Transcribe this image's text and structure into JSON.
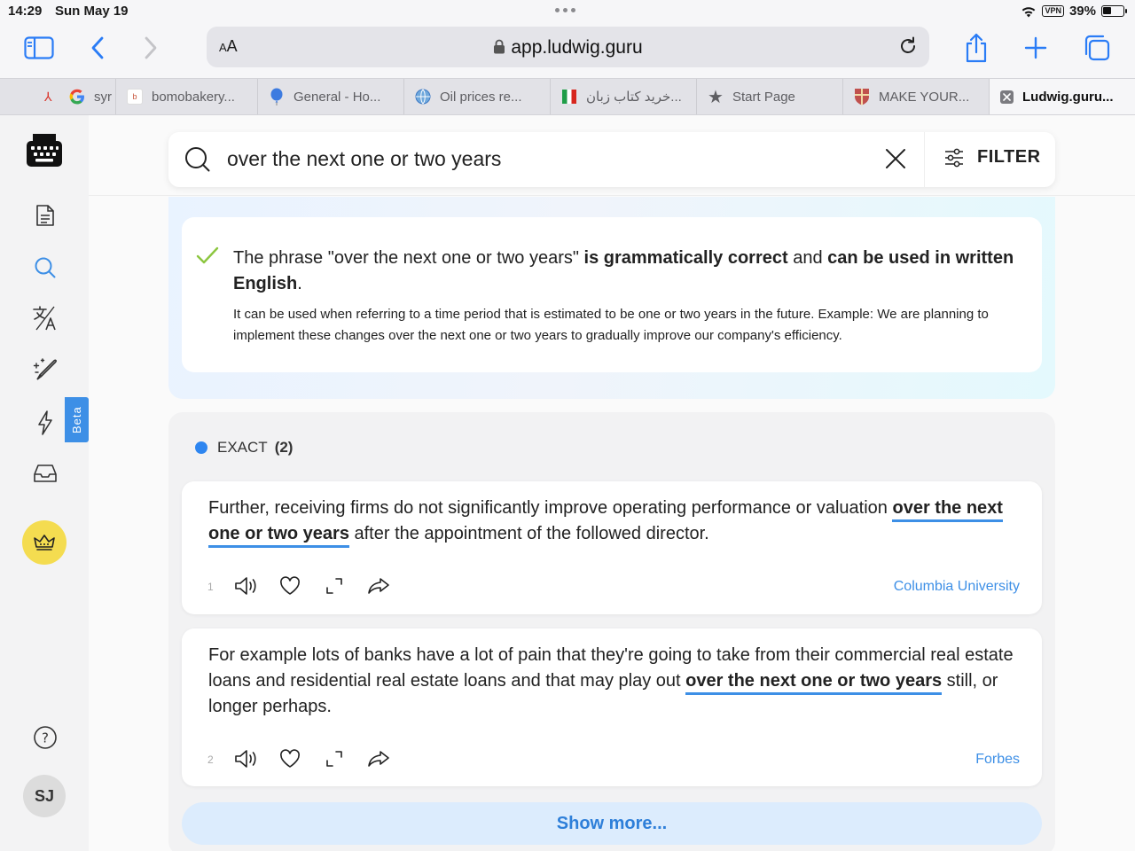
{
  "status": {
    "time": "14:29",
    "date": "Sun May 19",
    "vpn": "VPN",
    "battery": "39%"
  },
  "browser": {
    "text_size_label": "AA",
    "url": "app.ludwig.guru",
    "tabs": [
      {
        "label": "syr",
        "favicon": "google-icon"
      },
      {
        "label": "bomobakery...",
        "favicon": "page-icon"
      },
      {
        "label": "General - Ho...",
        "favicon": "balloon-icon"
      },
      {
        "label": "Oil prices re...",
        "favicon": "globe-icon"
      },
      {
        "label": "خرید کتاب زبان...",
        "favicon": "flag-icon"
      },
      {
        "label": "Start Page",
        "favicon": "star-icon"
      },
      {
        "label": "MAKE YOUR...",
        "favicon": "shield-icon"
      },
      {
        "label": "Ludwig.guru...",
        "favicon": "close-icon"
      }
    ]
  },
  "sidebar": {
    "beta_label": "Beta",
    "avatar_initials": "SJ"
  },
  "search": {
    "query": "over the next one or two years",
    "filter_label": "FILTER"
  },
  "verdict": {
    "prefix": "The phrase \"over the next one or two years\" ",
    "bold1": "is grammatically correct",
    "middle": " and ",
    "bold2": "can be used in written English",
    "suffix": ".",
    "description": "It can be used when referring to a time period that is estimated to be one or two years in the future. Example: We are planning to implement these changes over the next one or two years to gradually improve our company's efficiency."
  },
  "exact": {
    "label": "EXACT",
    "count": "(2)",
    "results": [
      {
        "number": "1",
        "before": "Further, receiving firms do not significantly improve operating performance or valuation ",
        "highlight_a": "over the next",
        "highlight_b": "one or two years",
        "after": " after the appointment of the followed director.",
        "source": "Columbia University"
      },
      {
        "number": "2",
        "before": "For example lots of banks have a lot of pain that they're going to take from their commercial real estate loans and residential real estate loans and that may play out ",
        "highlight": "over the next one or two years",
        "after": " still, or longer perhaps.",
        "source": "Forbes"
      }
    ],
    "show_more": "Show more..."
  }
}
